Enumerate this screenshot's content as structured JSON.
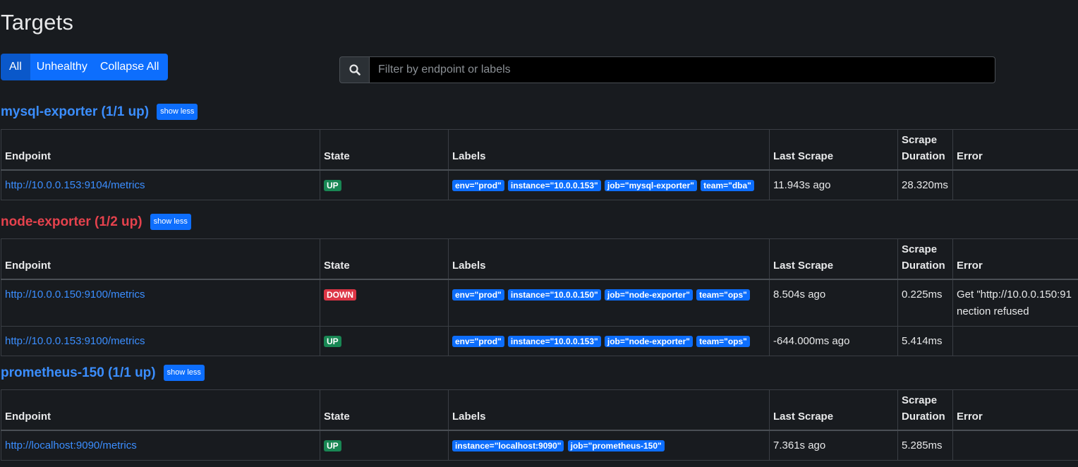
{
  "page": {
    "title": "Targets"
  },
  "filters": {
    "all_label": "All",
    "unhealthy_label": "Unhealthy",
    "collapse_label": "Collapse All"
  },
  "search": {
    "placeholder": "Filter by endpoint or labels"
  },
  "columns": {
    "endpoint": "Endpoint",
    "state": "State",
    "labels": "Labels",
    "last_scrape": "Last Scrape",
    "scrape_duration_1": "Scrape",
    "scrape_duration_2": "Duration",
    "error": "Error"
  },
  "show_less_label": "show less",
  "pools": [
    {
      "title": "mysql-exporter (1/1 up)",
      "health": "healthy",
      "targets": [
        {
          "endpoint": "http://10.0.0.153:9104/metrics",
          "state": "UP",
          "labels": [
            "env=\"prod\"",
            "instance=\"10.0.0.153\"",
            "job=\"mysql-exporter\"",
            "team=\"dba\""
          ],
          "last_scrape": "11.943s ago",
          "duration": "28.320ms",
          "error_line1": "",
          "error_line2": ""
        }
      ]
    },
    {
      "title": "node-exporter (1/2 up)",
      "health": "unhealthy",
      "targets": [
        {
          "endpoint": "http://10.0.0.150:9100/metrics",
          "state": "DOWN",
          "labels": [
            "env=\"prod\"",
            "instance=\"10.0.0.150\"",
            "job=\"node-exporter\"",
            "team=\"ops\""
          ],
          "last_scrape": "8.504s ago",
          "duration": "0.225ms",
          "error_line1": "Get \"http://10.0.0.150:91",
          "error_line2": "nection refused"
        },
        {
          "endpoint": "http://10.0.0.153:9100/metrics",
          "state": "UP",
          "labels": [
            "env=\"prod\"",
            "instance=\"10.0.0.153\"",
            "job=\"node-exporter\"",
            "team=\"ops\""
          ],
          "last_scrape": "-644.000ms ago",
          "duration": "5.414ms",
          "error_line1": "",
          "error_line2": ""
        }
      ]
    },
    {
      "title": "prometheus-150 (1/1 up)",
      "health": "healthy",
      "targets": [
        {
          "endpoint": "http://localhost:9090/metrics",
          "state": "UP",
          "labels": [
            "instance=\"localhost:9090\"",
            "job=\"prometheus-150\""
          ],
          "last_scrape": "7.361s ago",
          "duration": "5.285ms",
          "error_line1": "",
          "error_line2": ""
        }
      ]
    }
  ],
  "colors": {
    "background": "#181b1f",
    "primary": "#0d6efd",
    "link": "#3b8eff",
    "up": "#198754",
    "down": "#dc3545",
    "error_text": "#e5424d"
  },
  "icons": {
    "search": "search-icon"
  }
}
